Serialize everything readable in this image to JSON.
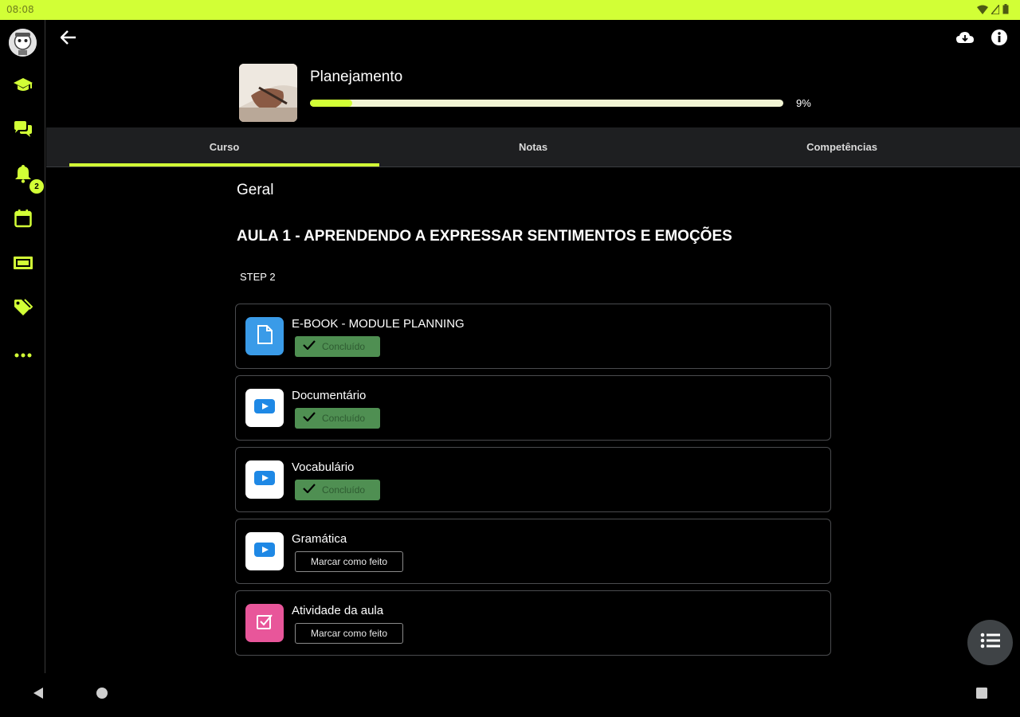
{
  "status_bar": {
    "time": "08:08"
  },
  "rail": {
    "items": [
      {
        "name": "courses",
        "icon": "graduation-cap-icon"
      },
      {
        "name": "messages",
        "icon": "chat-bubbles-icon"
      },
      {
        "name": "notifications",
        "icon": "bell-icon",
        "badge": "2"
      },
      {
        "name": "calendar",
        "icon": "calendar-icon"
      },
      {
        "name": "grades",
        "icon": "ticket-icon"
      },
      {
        "name": "tags",
        "icon": "tag-icon"
      },
      {
        "name": "more",
        "icon": "more-dots-icon"
      }
    ]
  },
  "course": {
    "title": "Planejamento",
    "progress_percent": 9,
    "progress_label": "9%"
  },
  "tabs": [
    {
      "label": "Curso",
      "active": true
    },
    {
      "label": "Notas",
      "active": false
    },
    {
      "label": "Competências",
      "active": false
    }
  ],
  "content": {
    "section": "Geral",
    "lesson": "AULA 1 - APRENDENDO A EXPRESSAR SENTIMENTOS E EMOÇÕES",
    "step": "STEP 2",
    "activities": [
      {
        "name": "E-BOOK - MODULE PLANNING",
        "type": "file",
        "status": "done",
        "status_label": "Concluído"
      },
      {
        "name": "Documentário",
        "type": "video",
        "status": "done",
        "status_label": "Concluído"
      },
      {
        "name": "Vocabulário",
        "type": "video",
        "status": "done",
        "status_label": "Concluído"
      },
      {
        "name": "Gramática",
        "type": "video",
        "status": "todo",
        "status_label": "Marcar como feito"
      },
      {
        "name": "Atividade da aula",
        "type": "assignment",
        "status": "todo",
        "status_label": "Marcar como feito"
      }
    ]
  },
  "colors": {
    "accent": "#d2ff36",
    "done_bg": "#4f8f52",
    "file_icon_bg": "#3a9be8",
    "video_icon_bg": "#ffffff",
    "assignment_icon_bg": "#e8569a",
    "tab_bar_bg": "#1e1f21"
  }
}
